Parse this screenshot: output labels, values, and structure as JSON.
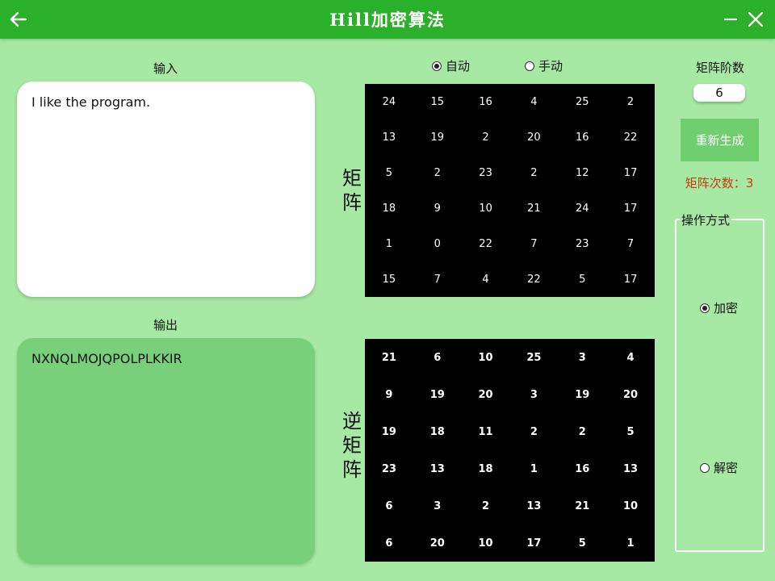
{
  "titlebar": {
    "title": "Hill加密算法",
    "back_icon": "arrow-left-icon",
    "minimize_icon": "minimize-icon",
    "close_icon": "close-icon"
  },
  "input": {
    "label": "输入",
    "value": "I like the program."
  },
  "output": {
    "label": "输出",
    "value": "NXNQLMOJQPOLPLKKIR"
  },
  "mode": {
    "auto_label": "自动",
    "manual_label": "手动",
    "selected": "auto"
  },
  "matrix": {
    "label_chars": [
      "矩",
      "阵"
    ],
    "rows": [
      [
        "24",
        "15",
        "16",
        "4",
        "25",
        "2"
      ],
      [
        "13",
        "19",
        "2",
        "20",
        "16",
        "22"
      ],
      [
        "5",
        "2",
        "23",
        "2",
        "12",
        "17"
      ],
      [
        "18",
        "9",
        "10",
        "21",
        "24",
        "17"
      ],
      [
        "1",
        "0",
        "22",
        "7",
        "23",
        "7"
      ],
      [
        "15",
        "7",
        "4",
        "22",
        "5",
        "17"
      ]
    ]
  },
  "inverse": {
    "label_chars": [
      "逆",
      "矩",
      "阵"
    ],
    "rows": [
      [
        "21",
        "6",
        "10",
        "25",
        "3",
        "4"
      ],
      [
        "9",
        "19",
        "20",
        "3",
        "19",
        "20"
      ],
      [
        "19",
        "18",
        "11",
        "2",
        "2",
        "5"
      ],
      [
        "23",
        "13",
        "18",
        "1",
        "16",
        "13"
      ],
      [
        "6",
        "3",
        "2",
        "13",
        "21",
        "10"
      ],
      [
        "6",
        "20",
        "10",
        "17",
        "5",
        "1"
      ]
    ]
  },
  "controls": {
    "order_label": "矩阵阶数",
    "order_value": "6",
    "regen_label": "重新生成",
    "count_text": "矩阵次数：3"
  },
  "operation": {
    "title": "操作方式",
    "encrypt_label": "加密",
    "decrypt_label": "解密",
    "selected": "encrypt"
  },
  "colors": {
    "titlebar": "#2bb02b",
    "background": "#a6e8a4",
    "output_box": "#79d07a",
    "regen_button": "#6fcf6f",
    "count_text": "#c83a14"
  }
}
